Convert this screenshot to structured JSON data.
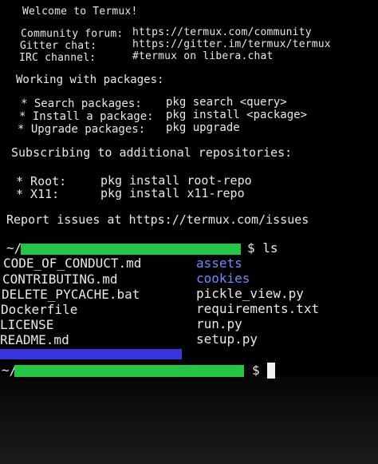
{
  "motd": {
    "welcome": "Welcome to Termux!",
    "community_label": "Community forum:",
    "community_url": "https://termux.com/community",
    "gitter_label": "Gitter chat:",
    "gitter_url": "https://gitter.im/termux/termux",
    "irc_label": "IRC channel:",
    "irc_value": "#termux on libera.chat",
    "packages_heading": "Working with packages:",
    "search_label": "* Search packages:",
    "search_cmd": "pkg search <query>",
    "install_label": "* Install a package:",
    "install_cmd": "pkg install <package>",
    "upgrade_label": "* Upgrade packages:",
    "upgrade_cmd": "pkg upgrade",
    "repos_heading": "Subscribing to additional repositories:",
    "root_label": "* Root:",
    "root_cmd": "pkg install root-repo",
    "x11_label": "* X11:",
    "x11_cmd": "pkg install x11-repo",
    "report": "Report issues at https://termux.com/issues"
  },
  "prompt1": {
    "prefix": "~/",
    "suffix": "$ ls"
  },
  "listing": {
    "left": [
      "CODE_OF_CONDUCT.md",
      "CONTRIBUTING.md",
      "DELETE_PYCACHE.bat",
      "Dockerfile",
      "LICENSE",
      "README.md"
    ],
    "right": [
      "assets",
      "cookies",
      "pickle_view.py",
      "requirements.txt",
      "run.py",
      "setup.py"
    ]
  },
  "prompt2": {
    "prefix": "~/",
    "suffix": "$"
  },
  "colors": {
    "directory": "#6a8cff",
    "redaction_green": "#27c44a",
    "redaction_blue": "#3a33e0",
    "text": "#e8e8e8"
  }
}
